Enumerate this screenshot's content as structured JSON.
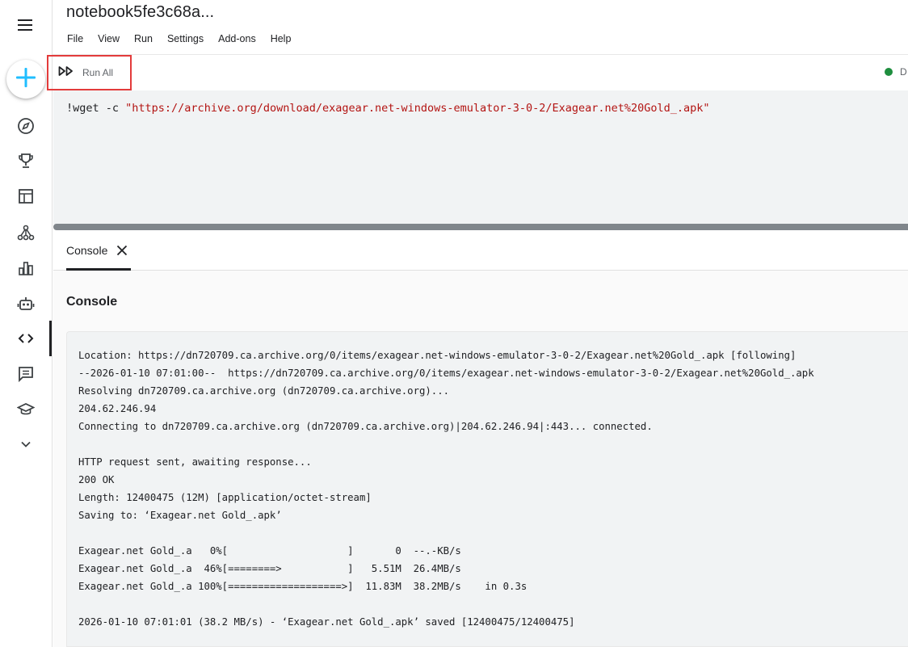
{
  "notebook": {
    "title": "notebook5fe3c68a..."
  },
  "menu": [
    "File",
    "View",
    "Run",
    "Settings",
    "Add-ons",
    "Help"
  ],
  "toolbar": {
    "run_all_label": "Run All",
    "status_label": "D"
  },
  "cell": {
    "prefix": "!wget -c ",
    "url": "\"https://archive.org/download/exagear.net-windows-emulator-3-0-2/Exagear.net%20Gold_.apk\""
  },
  "console": {
    "tab_label": "Console",
    "heading": "Console",
    "output_lines": [
      "Location: https://dn720709.ca.archive.org/0/items/exagear.net-windows-emulator-3-0-2/Exagear.net%20Gold_.apk [following]",
      "--2026-01-10 07:01:00--  https://dn720709.ca.archive.org/0/items/exagear.net-windows-emulator-3-0-2/Exagear.net%20Gold_.apk",
      "Resolving dn720709.ca.archive.org (dn720709.ca.archive.org)...",
      "204.62.246.94",
      "Connecting to dn720709.ca.archive.org (dn720709.ca.archive.org)|204.62.246.94|:443... connected.",
      "",
      "HTTP request sent, awaiting response...",
      "200 OK",
      "Length: 12400475 (12M) [application/octet-stream]",
      "Saving to: ‘Exagear.net Gold_.apk’",
      "",
      "Exagear.net Gold_.a   0%[                    ]       0  --.-KB/s",
      "Exagear.net Gold_.a  46%[========>           ]   5.51M  26.4MB/s",
      "Exagear.net Gold_.a 100%[===================>]  11.83M  38.2MB/s    in 0.3s",
      "",
      "2026-01-10 07:01:01 (38.2 MB/s) - ‘Exagear.net Gold_.apk’ saved [12400475/12400475]"
    ]
  },
  "colors": {
    "accent": "#20beff",
    "highlight_border": "#e33b3b",
    "status_ok": "#1e8e3e",
    "string": "#b31412"
  },
  "rail_icons": [
    "menu-icon",
    "plus-icon",
    "compass-icon",
    "trophy-icon",
    "table-icon",
    "network-icon",
    "bar-chart-icon",
    "robot-icon",
    "code-icon",
    "comment-icon",
    "graduation-cap-icon",
    "chevron-down-icon"
  ]
}
